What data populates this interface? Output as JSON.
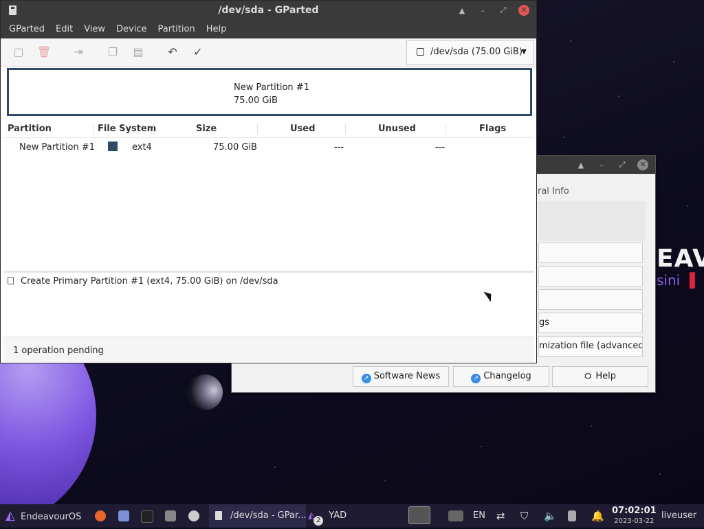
{
  "desktop": {
    "brand_text": "EAVOU",
    "brand_sub": "sini"
  },
  "bg_window": {
    "tab_fragment": "ral Info",
    "options": [
      "",
      "",
      "",
      "gs",
      "mization file (advanced)"
    ],
    "buttons": {
      "software_news": "Software News",
      "changelog": "Changelog",
      "help": "Help"
    }
  },
  "gparted": {
    "title": "/dev/sda - GParted",
    "menu": [
      "GParted",
      "Edit",
      "View",
      "Device",
      "Partition",
      "Help"
    ],
    "device_selector": "/dev/sda (75.00 GiB)",
    "diskmap": {
      "name": "New Partition #1",
      "size": "75.00 GiB"
    },
    "table": {
      "headers": [
        "Partition",
        "File System",
        "Size",
        "Used",
        "Unused",
        "Flags"
      ],
      "rows": [
        {
          "partition": "New Partition #1",
          "filesystem": "ext4",
          "fs_color": "#2e4a66",
          "size": "75.00 GiB",
          "used": "---",
          "unused": "---",
          "flags": ""
        }
      ]
    },
    "operations": [
      "Create Primary Partition #1 (ext4, 75.00 GiB) on /dev/sda"
    ],
    "status": "1 operation pending"
  },
  "taskbar": {
    "start": "EndeavourOS",
    "active_task": "/dev/sda - GPar...",
    "yad_task": "YAD",
    "yad_badge": "2",
    "lang": "EN",
    "time": "07:02:01",
    "date": "2023-03-22",
    "user": "liveuser"
  },
  "colors": {
    "accent": "#2e4a66",
    "close": "#e25555",
    "taskbar": "#1f1b33"
  }
}
